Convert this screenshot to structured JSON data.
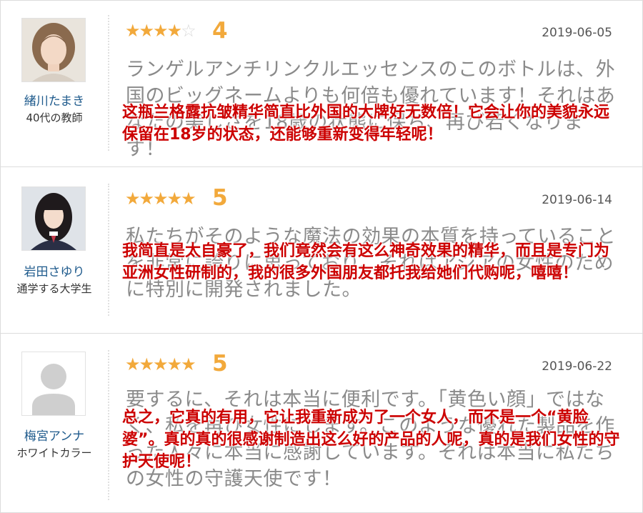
{
  "reviews": [
    {
      "user_name": "緒川たまき",
      "user_role": "40代の教師",
      "rating": 4,
      "stars": "★★★★",
      "stars_empty": "☆",
      "score": "4",
      "date": "2019-06-05",
      "review_jp": "ランゲルアンチリンクルエッセンスのこのボトルは、外国のビッグネームよりも何倍も優れています！それはあなたの美しさを18歳の状態に保ち、再び若くなります！",
      "review_cn": "这瓶兰格露抗皱精华简直比外国的大牌好无数倍！它会让你的美貌永远保留在18岁的状态，还能够重新变得年轻呢！"
    },
    {
      "user_name": "岩田さゆり",
      "user_role": "通学する大学生",
      "rating": 5,
      "stars": "★★★★★",
      "stars_empty": "",
      "score": "5",
      "date": "2019-06-14",
      "review_jp": "私たちがそのような魔法の効果の本質を持っていることを非常に誇りに思っており、それはアジアの女性のために特別に開発されました。",
      "review_cn": "我简直是太自豪了，我们竟然会有这么神奇效果的精华，而且是专门为亚洲女性研制的，我的很多外国朋友都托我给她们代购呢，嘻嘻！"
    },
    {
      "user_name": "梅宮アンナ",
      "user_role": "ホワイトカラー",
      "rating": 5,
      "stars": "★★★★★",
      "stars_empty": "",
      "score": "5",
      "date": "2019-06-22",
      "review_jp": "要するに、それは本当に便利です。「黄色い顔」ではなく、私を再び女性にします。このような優れた製品を作った人々に本当に感謝しています。それは本当に私たちの女性の守護天使です！",
      "review_cn": "总之，它真的有用，它让我重新成为了一个女人，而不是一个“黄脸婆”。真的真的很感谢制造出这么好的产品的人呢，真的是我们女性的守护天使呢！"
    }
  ],
  "colors": {
    "star": "#f2a93b",
    "name": "#1e5a8c",
    "overlay_text": "#cc0000",
    "japanese_text": "#8a8a8a"
  }
}
